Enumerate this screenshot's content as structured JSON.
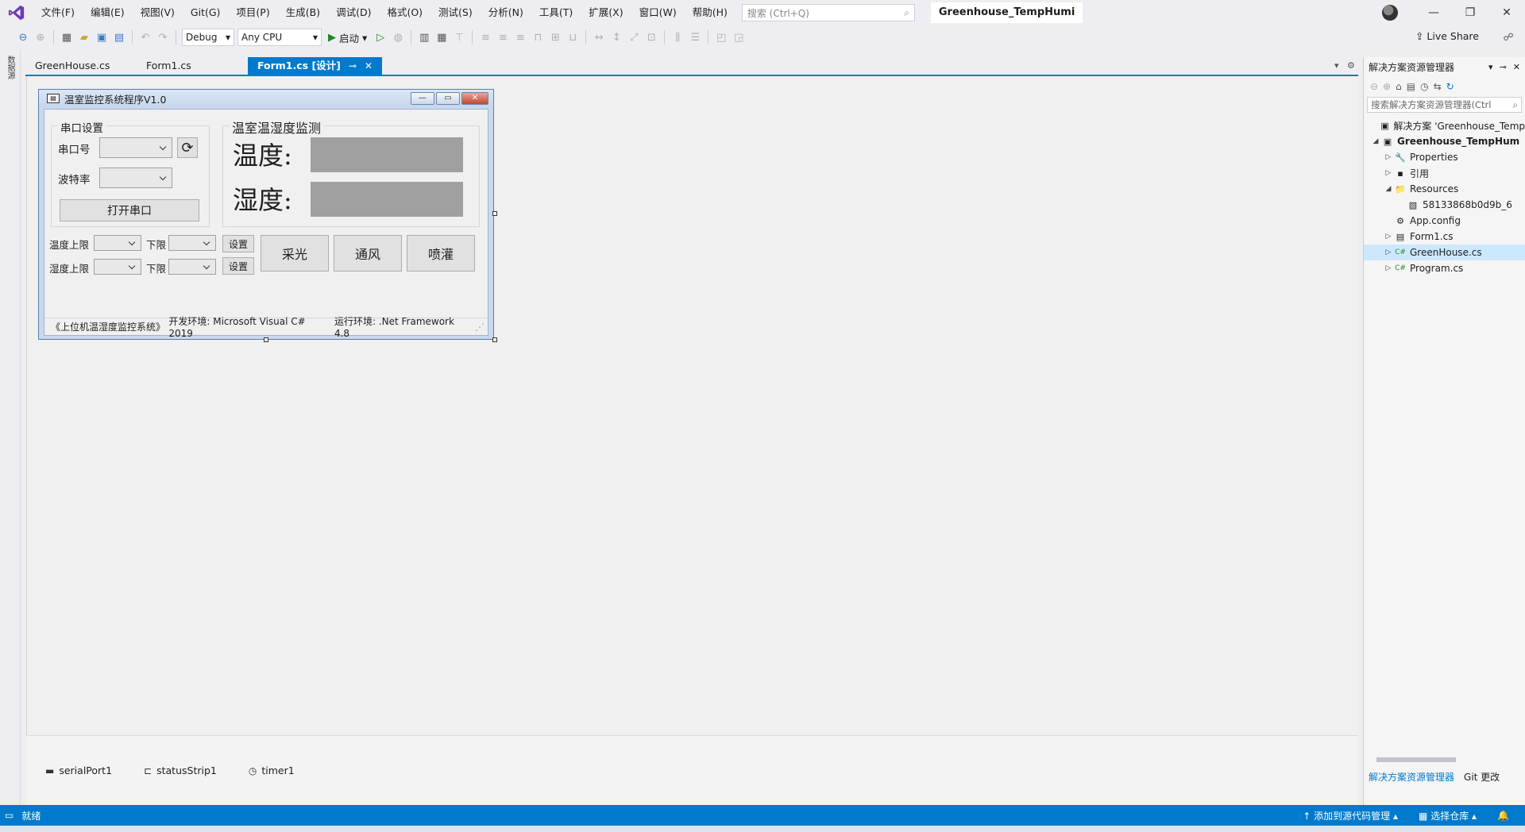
{
  "menu": {
    "items": [
      "文件(F)",
      "编辑(E)",
      "视图(V)",
      "Git(G)",
      "项目(P)",
      "生成(B)",
      "调试(D)",
      "格式(O)",
      "测试(S)",
      "分析(N)",
      "工具(T)",
      "扩展(X)",
      "窗口(W)",
      "帮助(H)"
    ],
    "search_placeholder": "搜索 (Ctrl+Q)",
    "solution_name": "Greenhouse_TempHumi"
  },
  "toolbar": {
    "config": "Debug",
    "platform": "Any CPU",
    "start_label": "启动",
    "live_share": "Live Share"
  },
  "left_strip": {
    "label": "数据源"
  },
  "tabs": [
    {
      "label": "GreenHouse.cs"
    },
    {
      "label": "Form1.cs"
    },
    {
      "label": "Form1.cs [设计]"
    }
  ],
  "form": {
    "title": "温室监控系统程序V1.0",
    "serial_group": "串口设置",
    "port_label": "串口号",
    "baud_label": "波特率",
    "open_button": "打开串口",
    "monitor_group": "温室温湿度监测",
    "temp_label": "温度:",
    "humi_label": "湿度:",
    "temp_upper": "温度上限",
    "humi_upper": "湿度上限",
    "lower_label": "下限",
    "set_label": "设置",
    "light_button": "采光",
    "vent_button": "通风",
    "spray_button": "喷灌",
    "status": [
      "《上位机温湿度监控系统》",
      "开发环境: Microsoft Visual C# 2019",
      "运行环境: .Net Framework 4.8"
    ]
  },
  "tray": [
    "serialPort1",
    "statusStrip1",
    "timer1"
  ],
  "solution_explorer": {
    "title": "解决方案资源管理器",
    "search_placeholder": "搜索解决方案资源管理器(Ctrl",
    "tree": [
      {
        "label": "解决方案 'Greenhouse_Temp",
        "indent": 0,
        "arrow": "",
        "icon": "▣"
      },
      {
        "label": "Greenhouse_TempHum",
        "indent": 0,
        "arrow": "◢",
        "icon": "▣",
        "bold": true
      },
      {
        "label": "Properties",
        "indent": 1,
        "arrow": "▷",
        "icon": "🔧"
      },
      {
        "label": "引用",
        "indent": 1,
        "arrow": "▷",
        "icon": "▪"
      },
      {
        "label": "Resources",
        "indent": 1,
        "arrow": "◢",
        "icon": "📁"
      },
      {
        "label": "58133868b0d9b_6",
        "indent": 2,
        "arrow": "",
        "icon": "▧"
      },
      {
        "label": "App.config",
        "indent": 1,
        "arrow": "",
        "icon": "⚙"
      },
      {
        "label": "Form1.cs",
        "indent": 1,
        "arrow": "▷",
        "icon": "▤"
      },
      {
        "label": "GreenHouse.cs",
        "indent": 1,
        "arrow": "▷",
        "icon": "C#",
        "selected": true
      },
      {
        "label": "Program.cs",
        "indent": 1,
        "arrow": "▷",
        "icon": "C#"
      }
    ],
    "bottom_tabs": [
      "解决方案资源管理器",
      "Git 更改"
    ]
  },
  "statusbar": {
    "ready": "就绪",
    "source_control": "添加到源代码管理",
    "repo": "选择仓库"
  },
  "colors": {
    "accent": "#007acc",
    "display": "#a0a0a0"
  }
}
